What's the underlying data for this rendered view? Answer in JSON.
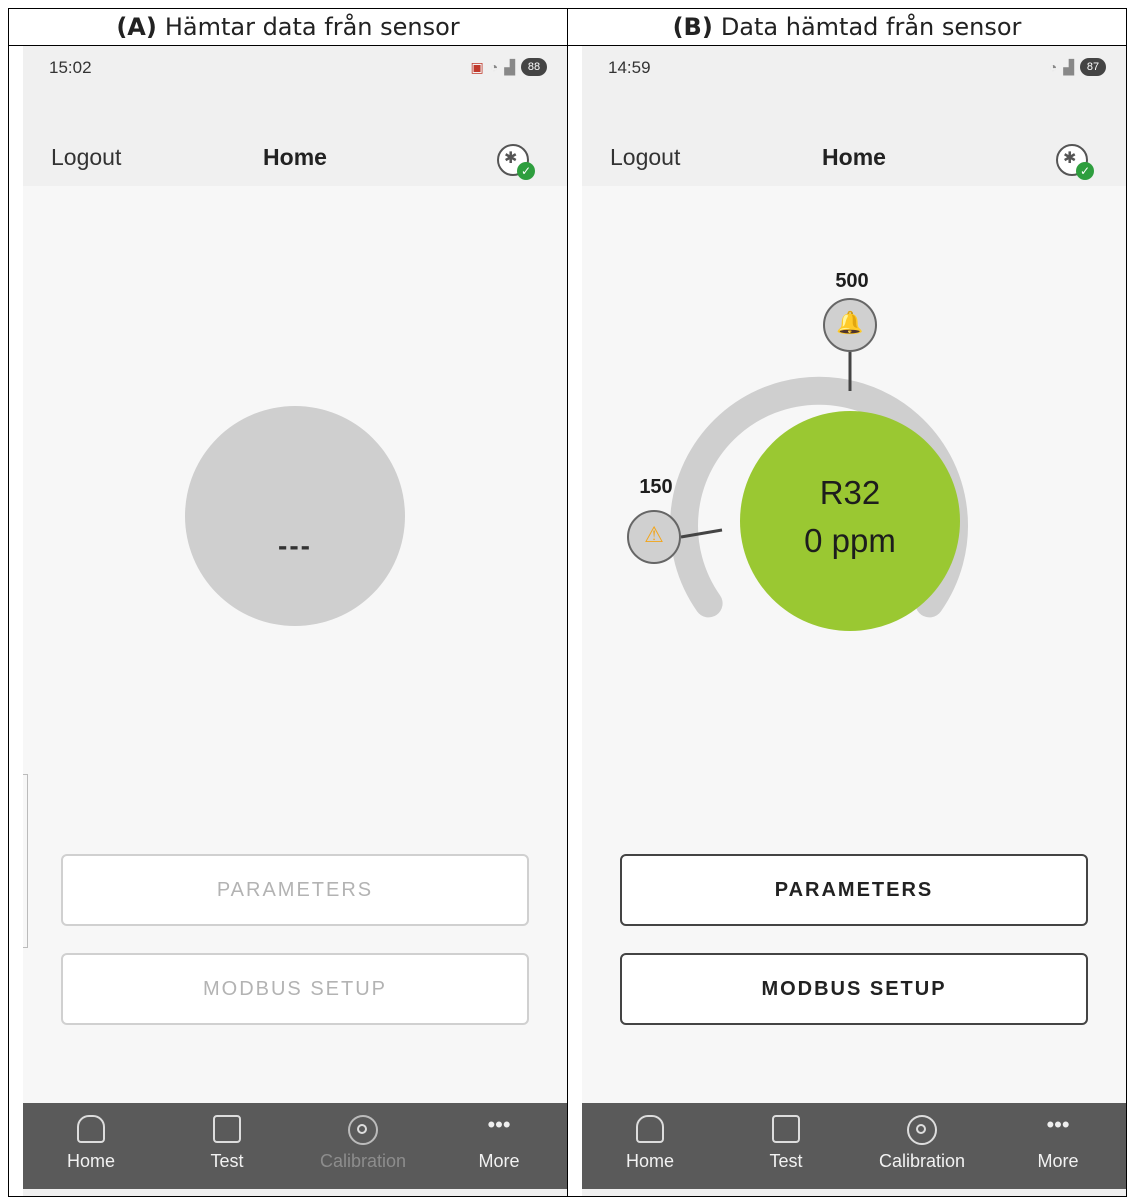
{
  "panels": {
    "a": {
      "caption_prefix": "(A)",
      "caption": "Hämtar data från sensor",
      "status_time": "15:02",
      "battery": "88",
      "logout": "Logout",
      "title": "Home",
      "reading": "---",
      "buttons": {
        "parameters": "PARAMETERS",
        "modbus": "MODBUS SETUP",
        "enabled": false
      },
      "nav": [
        {
          "label": "Home",
          "icon": "home-icon"
        },
        {
          "label": "Test",
          "icon": "test-icon"
        },
        {
          "label": "Calibration",
          "icon": "calibration-icon",
          "disabled": true
        },
        {
          "label": "More",
          "icon": "more-icon"
        }
      ],
      "sysnav": [
        "|||",
        "◯",
        "<"
      ]
    },
    "b": {
      "caption_prefix": "(B)",
      "caption": "Data hämtad från sensor",
      "status_time": "14:59",
      "battery": "87",
      "logout": "Logout",
      "title": "Home",
      "gas": "R32",
      "reading": "0 ppm",
      "alarm_threshold": "500",
      "warning_threshold": "150",
      "buttons": {
        "parameters": "PARAMETERS",
        "modbus": "MODBUS SETUP",
        "enabled": true
      },
      "nav": [
        {
          "label": "Home",
          "icon": "home-icon"
        },
        {
          "label": "Test",
          "icon": "test-icon"
        },
        {
          "label": "Calibration",
          "icon": "calibration-icon"
        },
        {
          "label": "More",
          "icon": "more-icon"
        }
      ],
      "sysnav": [
        "|||",
        "◯",
        "<"
      ]
    }
  },
  "colors": {
    "gauge_ok": "#9ac832",
    "gauge_track": "#cfcfcf",
    "gauge_idle": "#cfcfcf",
    "alarm": "#e04a1c",
    "warning": "#f2a51a",
    "connected": "#2e9e3e",
    "nav_bg": "#5a5a5a"
  }
}
